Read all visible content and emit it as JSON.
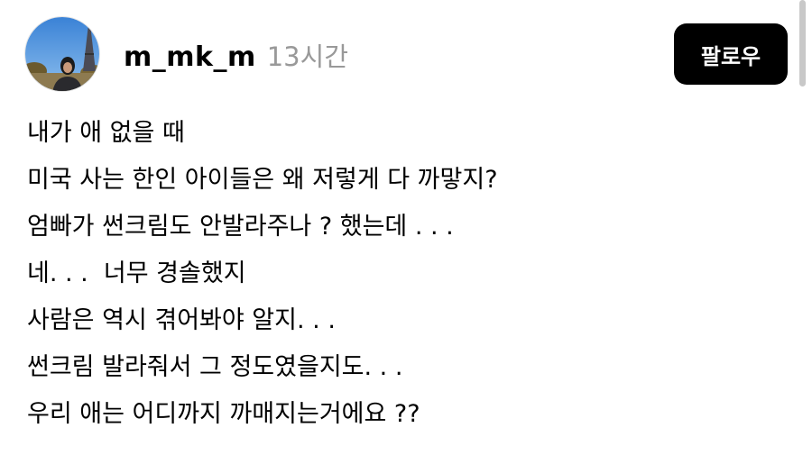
{
  "post": {
    "username": "m_mk_m",
    "timestamp": "13시간",
    "follow_label": "팔로우",
    "lines": [
      "내가 애 없을 때",
      "미국 사는 한인 아이들은 왜 저렇게 다 까맣지?",
      "엄빠가 썬크림도 안발라주나 ? 했는데 . . .",
      "네. . .  너무 경솔했지",
      "사람은 역시 겪어봐야 알지. . .",
      "썬크림 발라줘서 그 정도였을지도. . .",
      "우리 애는 어디까지 까매지는거에요 ??"
    ]
  },
  "colors": {
    "button_bg": "#000000",
    "button_text": "#ffffff",
    "timestamp": "#999999"
  }
}
